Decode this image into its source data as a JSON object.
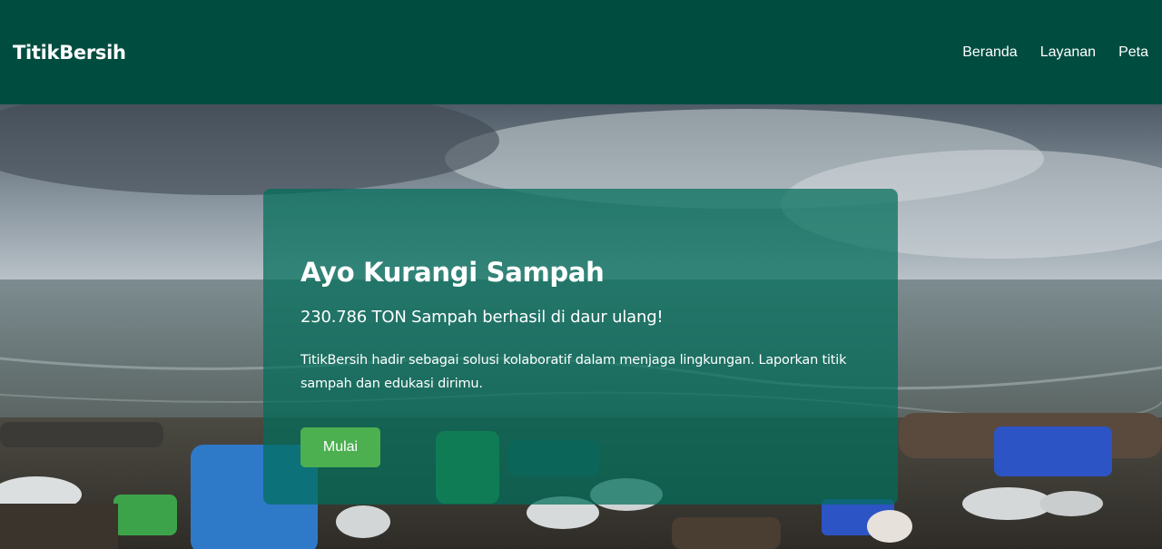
{
  "navbar": {
    "brand": "TitikBersih",
    "links": [
      {
        "label": "Beranda"
      },
      {
        "label": "Layanan"
      },
      {
        "label": "Peta"
      }
    ]
  },
  "hero": {
    "title": "Ayo Kurangi Sampah",
    "subtitle": "230.786 TON Sampah berhasil di daur ulang!",
    "description": "TitikBersih hadir sebagai solusi kolaboratif dalam menjaga lingkungan. Laporkan titik sampah dan edukasi dirimu.",
    "cta_label": "Mulai"
  },
  "colors": {
    "navbar_bg": "#004d40",
    "card_bg": "rgba(0,110,90,0.72)",
    "button_bg": "#4caf50"
  }
}
